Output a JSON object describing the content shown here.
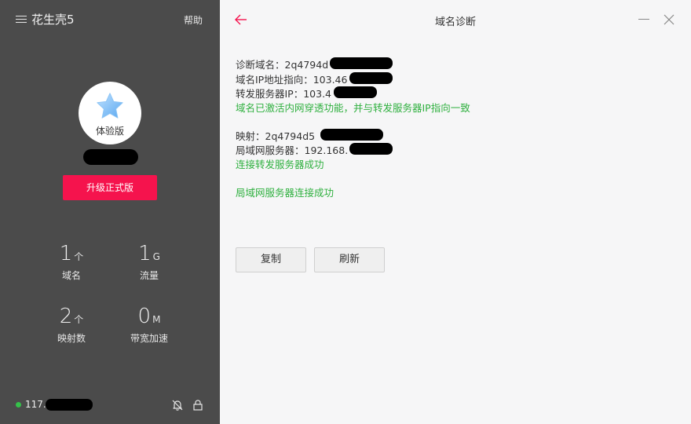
{
  "sidebar": {
    "app_title": "花生壳5",
    "help_label": "帮助",
    "edition_label": "体验版",
    "upgrade_label": "升级正式版",
    "stats": [
      {
        "value": "1",
        "unit": "个",
        "label": "域名"
      },
      {
        "value": "1",
        "unit": "G",
        "label": "流量"
      },
      {
        "value": "2",
        "unit": "个",
        "label": "映射数"
      },
      {
        "value": "0",
        "unit": "M",
        "label": "带宽加速"
      }
    ],
    "ip_prefix": "117.",
    "status_color": "#35c14a"
  },
  "main": {
    "title": "域名诊断",
    "lines": {
      "diag_domain": "诊断域名：2q4794d",
      "domain_ip": "域名IP地址指向：103.46",
      "forward_ip": "转发服务器IP：103.4",
      "status_penetration": "域名已激活内网穿透功能，并与转发服务器IP指向一致",
      "mapping": "映射：2q4794d5",
      "lan_server": "局域网服务器：192.168.",
      "status_forward_ok": "连接转发服务器成功",
      "status_lan_ok": "局域网服务器连接成功"
    },
    "buttons": {
      "copy": "复制",
      "refresh": "刷新"
    }
  },
  "colors": {
    "accent": "#f5134d",
    "success": "#2fb03f",
    "sidebar_bg": "#4b4b4b"
  },
  "icons": [
    "menu-icon",
    "star-icon",
    "bell-off-icon",
    "lock-icon",
    "back-arrow-icon",
    "minimize-icon",
    "close-icon"
  ]
}
